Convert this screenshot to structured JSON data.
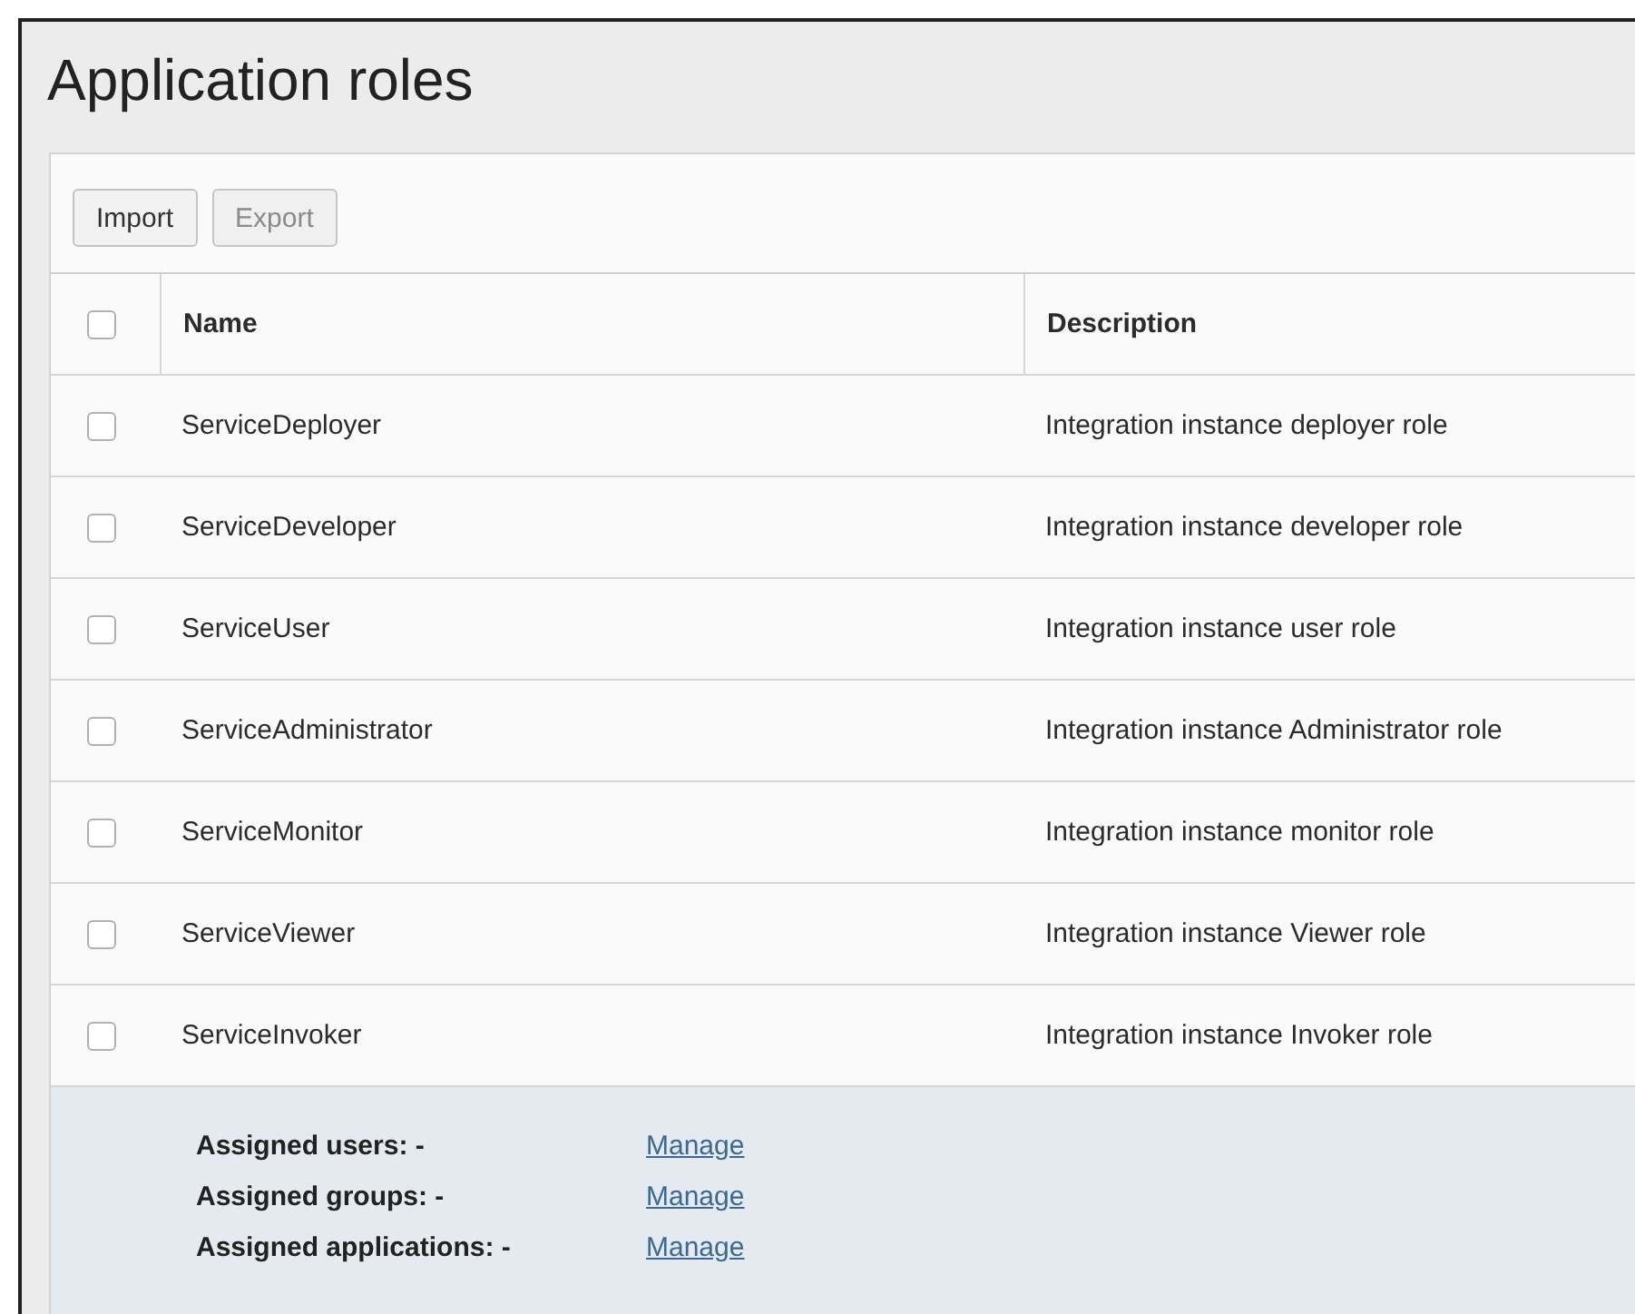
{
  "page": {
    "title": "Application roles"
  },
  "toolbar": [
    {
      "label": "Import",
      "disabled": false
    },
    {
      "label": "Export",
      "disabled": true
    }
  ],
  "table": {
    "select_all": {
      "checked": false
    },
    "columns": [
      "Name",
      "Description"
    ],
    "rows": [
      {
        "name": "ServiceDeployer",
        "description": "Integration instance deployer role",
        "checked": false
      },
      {
        "name": "ServiceDeveloper",
        "description": "Integration instance developer role",
        "checked": false
      },
      {
        "name": "ServiceUser",
        "description": "Integration instance user role",
        "checked": false
      },
      {
        "name": "ServiceAdministrator",
        "description": "Integration instance Administrator role",
        "checked": false
      },
      {
        "name": "ServiceMonitor",
        "description": "Integration instance monitor role",
        "checked": false
      },
      {
        "name": "ServiceViewer",
        "description": "Integration instance Viewer role",
        "checked": false
      },
      {
        "name": "ServiceInvoker",
        "description": "Integration instance Invoker role",
        "checked": false
      }
    ]
  },
  "details": [
    {
      "label": "Assigned users: -",
      "link": "Manage"
    },
    {
      "label": "Assigned groups: -",
      "link": "Manage"
    },
    {
      "label": "Assigned applications: -",
      "link": "Manage"
    }
  ]
}
